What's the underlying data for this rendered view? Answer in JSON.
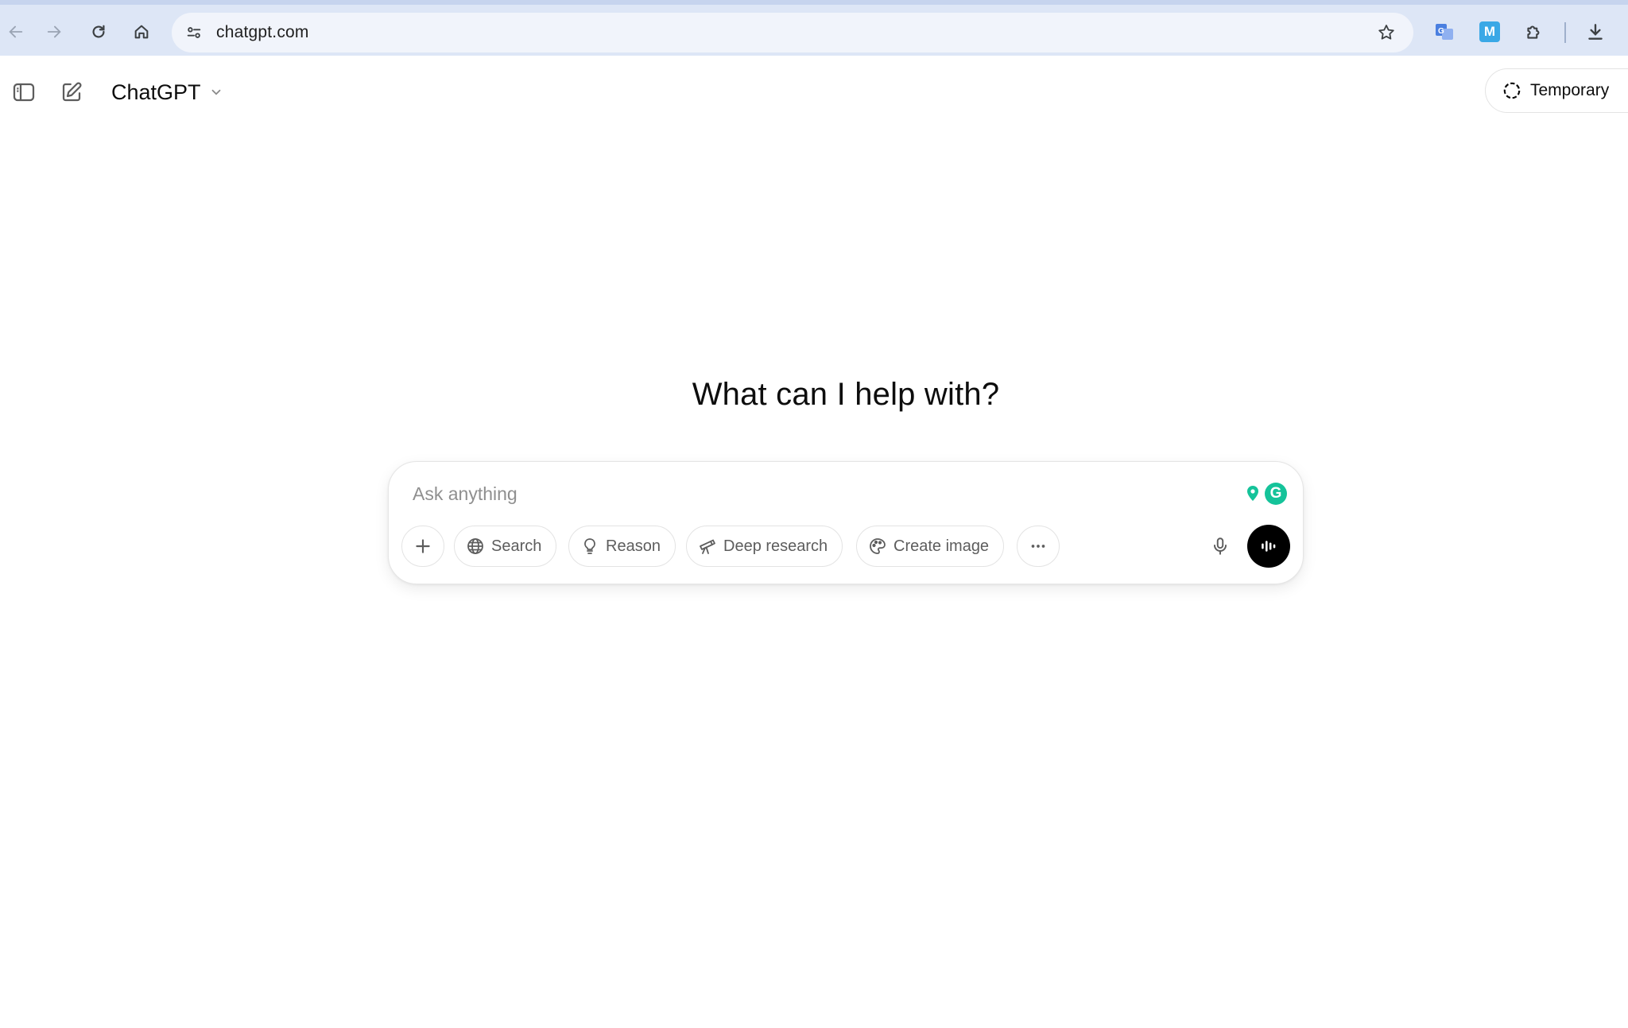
{
  "browser": {
    "url": "chatgpt.com",
    "icons": {
      "back": "arrow-left-icon",
      "forward": "arrow-right-icon",
      "reload": "reload-icon",
      "home": "home-icon",
      "site_info": "tune-icon",
      "bookmark": "star-icon",
      "translate_ext": "translate-icon",
      "m_ext": "m-extension-icon",
      "extensions": "puzzle-icon",
      "downloads": "download-icon"
    },
    "m_ext_letter": "M"
  },
  "header": {
    "model_name": "ChatGPT",
    "temporary_label": "Temporary",
    "icons": {
      "sidebar_toggle": "sidebar-icon",
      "new_chat": "pencil-square-icon",
      "model_dropdown": "chevron-down-icon",
      "temporary": "dashed-circle-icon"
    }
  },
  "hero": {
    "title": "What can I help with?"
  },
  "composer": {
    "placeholder": "Ask anything",
    "tools": [
      {
        "label": "Search",
        "icon": "globe-icon"
      },
      {
        "label": "Reason",
        "icon": "lightbulb-icon"
      },
      {
        "label": "Deep research",
        "icon": "telescope-icon"
      },
      {
        "label": "Create image",
        "icon": "palette-icon"
      }
    ],
    "icons": {
      "add": "plus-icon",
      "more": "ellipsis-icon",
      "mic": "microphone-icon",
      "voice": "voice-waveform-icon",
      "grammarly": "grammarly-icon"
    },
    "grammarly_letter": "G"
  },
  "colors": {
    "browser_bar": "#dde6f6",
    "omnibox": "#f1f4fb",
    "voice_button": "#000000",
    "grammarly_green": "#15c39a",
    "translate_blue": "#4a7fe0"
  }
}
